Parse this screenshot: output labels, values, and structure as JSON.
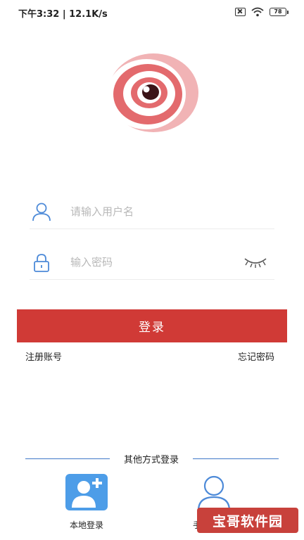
{
  "status_bar": {
    "time_speed": "下午3:32 | 12.1K/s",
    "battery": "78"
  },
  "login": {
    "username_placeholder": "请输入用户名",
    "password_placeholder": "输入密码",
    "submit_label": "登录",
    "register_link": "注册账号",
    "forgot_link": "忘记密码"
  },
  "other_methods": {
    "title": "其他方式登录",
    "local_label": "本地登录",
    "phone_label": "手机号登录"
  },
  "watermark": {
    "text": "宝哥软件园"
  },
  "colors": {
    "accent": "#d03a36",
    "logo_light": "#f1b3b5",
    "logo_dark": "#e36a6d",
    "link_blue": "#3f78c8",
    "icon_blue": "#4d9de8"
  }
}
